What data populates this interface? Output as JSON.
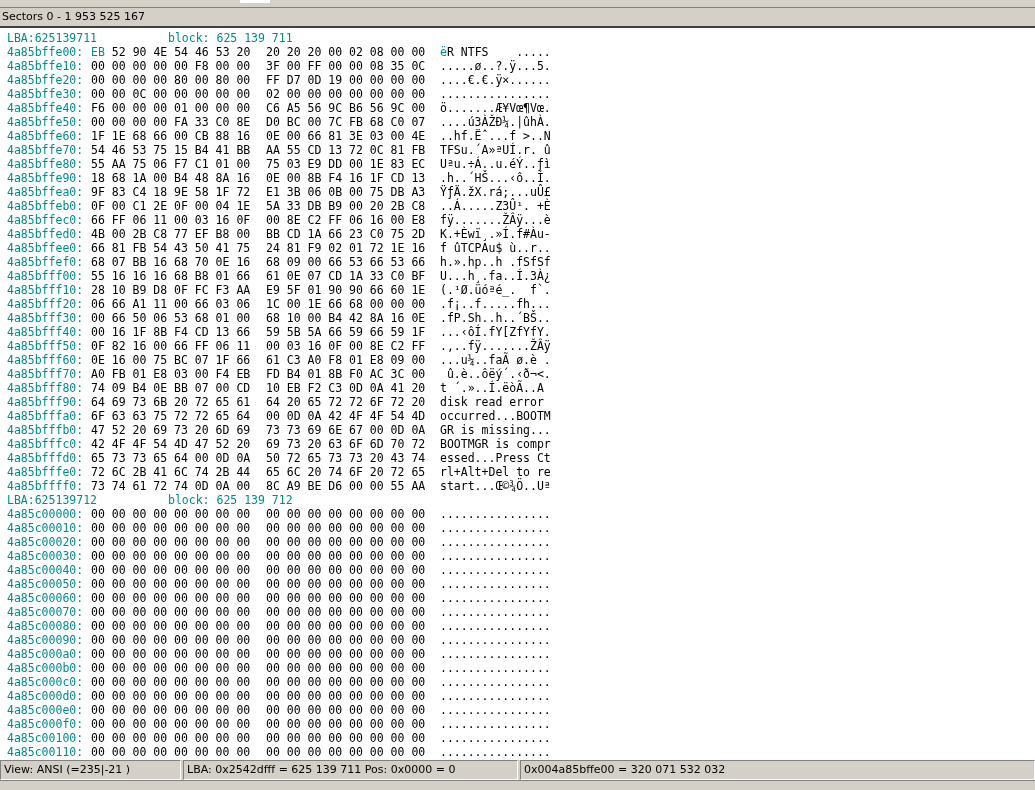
{
  "header": {
    "title": "Sectors 0 - 1 953 525 167"
  },
  "blocks": [
    {
      "lba": "LBA:625139711",
      "block": "block: 625 139 711",
      "rows": [
        {
          "address": "4a85bffe00:",
          "cursor": {
            "hex": "EB",
            "char": "ë"
          },
          "hex_left": "52 90 4E 54 46 53 20",
          "hex_right": "20 20 20 00 02 08 00 00",
          "ascii": "R NTFS    ....."
        },
        {
          "address": "4a85bffe10:",
          "hex_left": "00 00 00 00 00 F8 00 00",
          "hex_right": "3F 00 FF 00 00 08 35 0C",
          "ascii": ".....ø..?.ÿ...5."
        },
        {
          "address": "4a85bffe20:",
          "hex_left": "00 00 00 00 80 00 80 00",
          "hex_right": "FF D7 0D 19 00 00 00 00",
          "ascii": "....€.€.ÿ×......"
        },
        {
          "address": "4a85bffe30:",
          "hex_left": "00 00 0C 00 00 00 00 00",
          "hex_right": "02 00 00 00 00 00 00 00",
          "ascii": "................"
        },
        {
          "address": "4a85bffe40:",
          "hex_left": "F6 00 00 00 01 00 00 00",
          "hex_right": "C6 A5 56 9C B6 56 9C 00",
          "ascii": "ö.......Æ¥Vœ¶Vœ."
        },
        {
          "address": "4a85bffe50:",
          "hex_left": "00 00 00 00 FA 33 C0 8E",
          "hex_right": "D0 BC 00 7C FB 68 C0 07",
          "ascii": "....ú3ÀŽÐ¼.|ûhÀ."
        },
        {
          "address": "4a85bffe60:",
          "hex_left": "1F 1E 68 66 00 CB 88 16",
          "hex_right": "0E 00 66 81 3E 03 00 4E",
          "ascii": "..hf.Ëˆ...f >..N"
        },
        {
          "address": "4a85bffe70:",
          "hex_left": "54 46 53 75 15 B4 41 BB",
          "hex_right": "AA 55 CD 13 72 0C 81 FB",
          "ascii": "TFSu.´A»ªUÍ.r. û"
        },
        {
          "address": "4a85bffe80:",
          "hex_left": "55 AA 75 06 F7 C1 01 00",
          "hex_right": "75 03 E9 DD 00 1E 83 EC",
          "ascii": "Uªu.÷Á..u.éÝ..ƒì"
        },
        {
          "address": "4a85bffe90:",
          "hex_left": "18 68 1A 00 B4 48 8A 16",
          "hex_right": "0E 00 8B F4 16 1F CD 13",
          "ascii": ".h..´HŠ...‹ô..Í."
        },
        {
          "address": "4a85bffea0:",
          "hex_left": "9F 83 C4 18 9E 58 1F 72",
          "hex_right": "E1 3B 06 0B 00 75 DB A3",
          "ascii": "ŸƒÄ.žX.rá;...uÛ£"
        },
        {
          "address": "4a85bffeb0:",
          "hex_left": "0F 00 C1 2E 0F 00 04 1E",
          "hex_right": "5A 33 DB B9 00 20 2B C8",
          "ascii": "..Á.....Z3Û¹. +È"
        },
        {
          "address": "4a85bffec0:",
          "hex_left": "66 FF 06 11 00 03 16 0F",
          "hex_right": "00 8E C2 FF 06 16 00 E8",
          "ascii": "fÿ.......ŽÂÿ...è"
        },
        {
          "address": "4a85bffed0:",
          "hex_left": "4B 00 2B C8 77 EF B8 00",
          "hex_right": "BB CD 1A 66 23 C0 75 2D",
          "ascii": "K.+Èwï¸.»Í.f#Àu-"
        },
        {
          "address": "4a85bffee0:",
          "hex_left": "66 81 FB 54 43 50 41 75",
          "hex_right": "24 81 F9 02 01 72 1E 16",
          "ascii": "f ûTCPAu$ ù..r.."
        },
        {
          "address": "4a85bffef0:",
          "hex_left": "68 07 BB 16 68 70 0E 16",
          "hex_right": "68 09 00 66 53 66 53 66",
          "ascii": "h.».hp..h .fSfSf"
        },
        {
          "address": "4a85bfff00:",
          "hex_left": "55 16 16 16 68 B8 01 66",
          "hex_right": "61 0E 07 CD 1A 33 C0 BF",
          "ascii": "U...h¸.fa..Í.3À¿"
        },
        {
          "address": "4a85bfff10:",
          "hex_left": "28 10 B9 D8 0F FC F3 AA",
          "hex_right": "E9 5F 01 90 90 66 60 1E",
          "ascii": "(.¹Ø.üóªé_.  f`."
        },
        {
          "address": "4a85bfff20:",
          "hex_left": "06 66 A1 11 00 66 03 06",
          "hex_right": "1C 00 1E 66 68 00 00 00",
          "ascii": ".f¡..f.....fh..."
        },
        {
          "address": "4a85bfff30:",
          "hex_left": "00 66 50 06 53 68 01 00",
          "hex_right": "68 10 00 B4 42 8A 16 0E",
          "ascii": ".fP.Sh..h..´BŠ.."
        },
        {
          "address": "4a85bfff40:",
          "hex_left": "00 16 1F 8B F4 CD 13 66",
          "hex_right": "59 5B 5A 66 59 66 59 1F",
          "ascii": "...‹ôÍ.fY[ZfYfY."
        },
        {
          "address": "4a85bfff50:",
          "hex_left": "0F 82 16 00 66 FF 06 11",
          "hex_right": "00 03 16 0F 00 8E C2 FF",
          "ascii": ".‚..fÿ.......ŽÂÿ"
        },
        {
          "address": "4a85bfff60:",
          "hex_left": "0E 16 00 75 BC 07 1F 66",
          "hex_right": "61 C3 A0 F8 01 E8 09 00",
          "ascii": "...u¼..faÃ ø.è ."
        },
        {
          "address": "4a85bfff70:",
          "hex_left": "A0 FB 01 E8 03 00 F4 EB",
          "hex_right": "FD B4 01 8B F0 AC 3C 00",
          "ascii": " û.è..ôëý´.‹ð¬<."
        },
        {
          "address": "4a85bfff80:",
          "hex_left": "74 09 B4 0E BB 07 00 CD",
          "hex_right": "10 EB F2 C3 0D 0A 41 20",
          "ascii": "t ´.»..Í.ëòÃ..A "
        },
        {
          "address": "4a85bfff90:",
          "hex_left": "64 69 73 6B 20 72 65 61",
          "hex_right": "64 20 65 72 72 6F 72 20",
          "ascii": "disk read error "
        },
        {
          "address": "4a85bfffa0:",
          "hex_left": "6F 63 63 75 72 72 65 64",
          "hex_right": "00 0D 0A 42 4F 4F 54 4D",
          "ascii": "occurred...BOOTM"
        },
        {
          "address": "4a85bfffb0:",
          "hex_left": "47 52 20 69 73 20 6D 69",
          "hex_right": "73 73 69 6E 67 00 0D 0A",
          "ascii": "GR is missing..."
        },
        {
          "address": "4a85bfffc0:",
          "hex_left": "42 4F 4F 54 4D 47 52 20",
          "hex_right": "69 73 20 63 6F 6D 70 72",
          "ascii": "BOOTMGR is compr"
        },
        {
          "address": "4a85bfffd0:",
          "hex_left": "65 73 73 65 64 00 0D 0A",
          "hex_right": "50 72 65 73 73 20 43 74",
          "ascii": "essed...Press Ct"
        },
        {
          "address": "4a85bfffe0:",
          "hex_left": "72 6C 2B 41 6C 74 2B 44",
          "hex_right": "65 6C 20 74 6F 20 72 65",
          "ascii": "rl+Alt+Del to re"
        },
        {
          "address": "4a85bffff0:",
          "hex_left": "73 74 61 72 74 0D 0A 00",
          "hex_right": "8C A9 BE D6 00 00 55 AA",
          "ascii": "start...Œ©¾Ö..Uª"
        }
      ]
    },
    {
      "lba": "LBA:625139712",
      "block": "block: 625 139 712",
      "rows": [
        {
          "address": "4a85c00000:",
          "hex_left": "00 00 00 00 00 00 00 00",
          "hex_right": "00 00 00 00 00 00 00 00",
          "ascii": "................"
        },
        {
          "address": "4a85c00010:",
          "hex_left": "00 00 00 00 00 00 00 00",
          "hex_right": "00 00 00 00 00 00 00 00",
          "ascii": "................"
        },
        {
          "address": "4a85c00020:",
          "hex_left": "00 00 00 00 00 00 00 00",
          "hex_right": "00 00 00 00 00 00 00 00",
          "ascii": "................"
        },
        {
          "address": "4a85c00030:",
          "hex_left": "00 00 00 00 00 00 00 00",
          "hex_right": "00 00 00 00 00 00 00 00",
          "ascii": "................"
        },
        {
          "address": "4a85c00040:",
          "hex_left": "00 00 00 00 00 00 00 00",
          "hex_right": "00 00 00 00 00 00 00 00",
          "ascii": "................"
        },
        {
          "address": "4a85c00050:",
          "hex_left": "00 00 00 00 00 00 00 00",
          "hex_right": "00 00 00 00 00 00 00 00",
          "ascii": "................"
        },
        {
          "address": "4a85c00060:",
          "hex_left": "00 00 00 00 00 00 00 00",
          "hex_right": "00 00 00 00 00 00 00 00",
          "ascii": "................"
        },
        {
          "address": "4a85c00070:",
          "hex_left": "00 00 00 00 00 00 00 00",
          "hex_right": "00 00 00 00 00 00 00 00",
          "ascii": "................"
        },
        {
          "address": "4a85c00080:",
          "hex_left": "00 00 00 00 00 00 00 00",
          "hex_right": "00 00 00 00 00 00 00 00",
          "ascii": "................"
        },
        {
          "address": "4a85c00090:",
          "hex_left": "00 00 00 00 00 00 00 00",
          "hex_right": "00 00 00 00 00 00 00 00",
          "ascii": "................"
        },
        {
          "address": "4a85c000a0:",
          "hex_left": "00 00 00 00 00 00 00 00",
          "hex_right": "00 00 00 00 00 00 00 00",
          "ascii": "................"
        },
        {
          "address": "4a85c000b0:",
          "hex_left": "00 00 00 00 00 00 00 00",
          "hex_right": "00 00 00 00 00 00 00 00",
          "ascii": "................"
        },
        {
          "address": "4a85c000c0:",
          "hex_left": "00 00 00 00 00 00 00 00",
          "hex_right": "00 00 00 00 00 00 00 00",
          "ascii": "................"
        },
        {
          "address": "4a85c000d0:",
          "hex_left": "00 00 00 00 00 00 00 00",
          "hex_right": "00 00 00 00 00 00 00 00",
          "ascii": "................"
        },
        {
          "address": "4a85c000e0:",
          "hex_left": "00 00 00 00 00 00 00 00",
          "hex_right": "00 00 00 00 00 00 00 00",
          "ascii": "................"
        },
        {
          "address": "4a85c000f0:",
          "hex_left": "00 00 00 00 00 00 00 00",
          "hex_right": "00 00 00 00 00 00 00 00",
          "ascii": "................"
        },
        {
          "address": "4a85c00100:",
          "hex_left": "00 00 00 00 00 00 00 00",
          "hex_right": "00 00 00 00 00 00 00 00",
          "ascii": "................"
        },
        {
          "address": "4a85c00110:",
          "hex_left": "00 00 00 00 00 00 00 00",
          "hex_right": "00 00 00 00 00 00 00 00",
          "ascii": "................"
        }
      ]
    }
  ],
  "status_bar": [
    {
      "text": "View: ANSI (=235|-21 )"
    },
    {
      "text": "LBA: 0x2542dfff = 625 139 711  Pos: 0x0000 = 0"
    },
    {
      "text": "0x004a85bffe00 = 320 071 532 032"
    }
  ]
}
